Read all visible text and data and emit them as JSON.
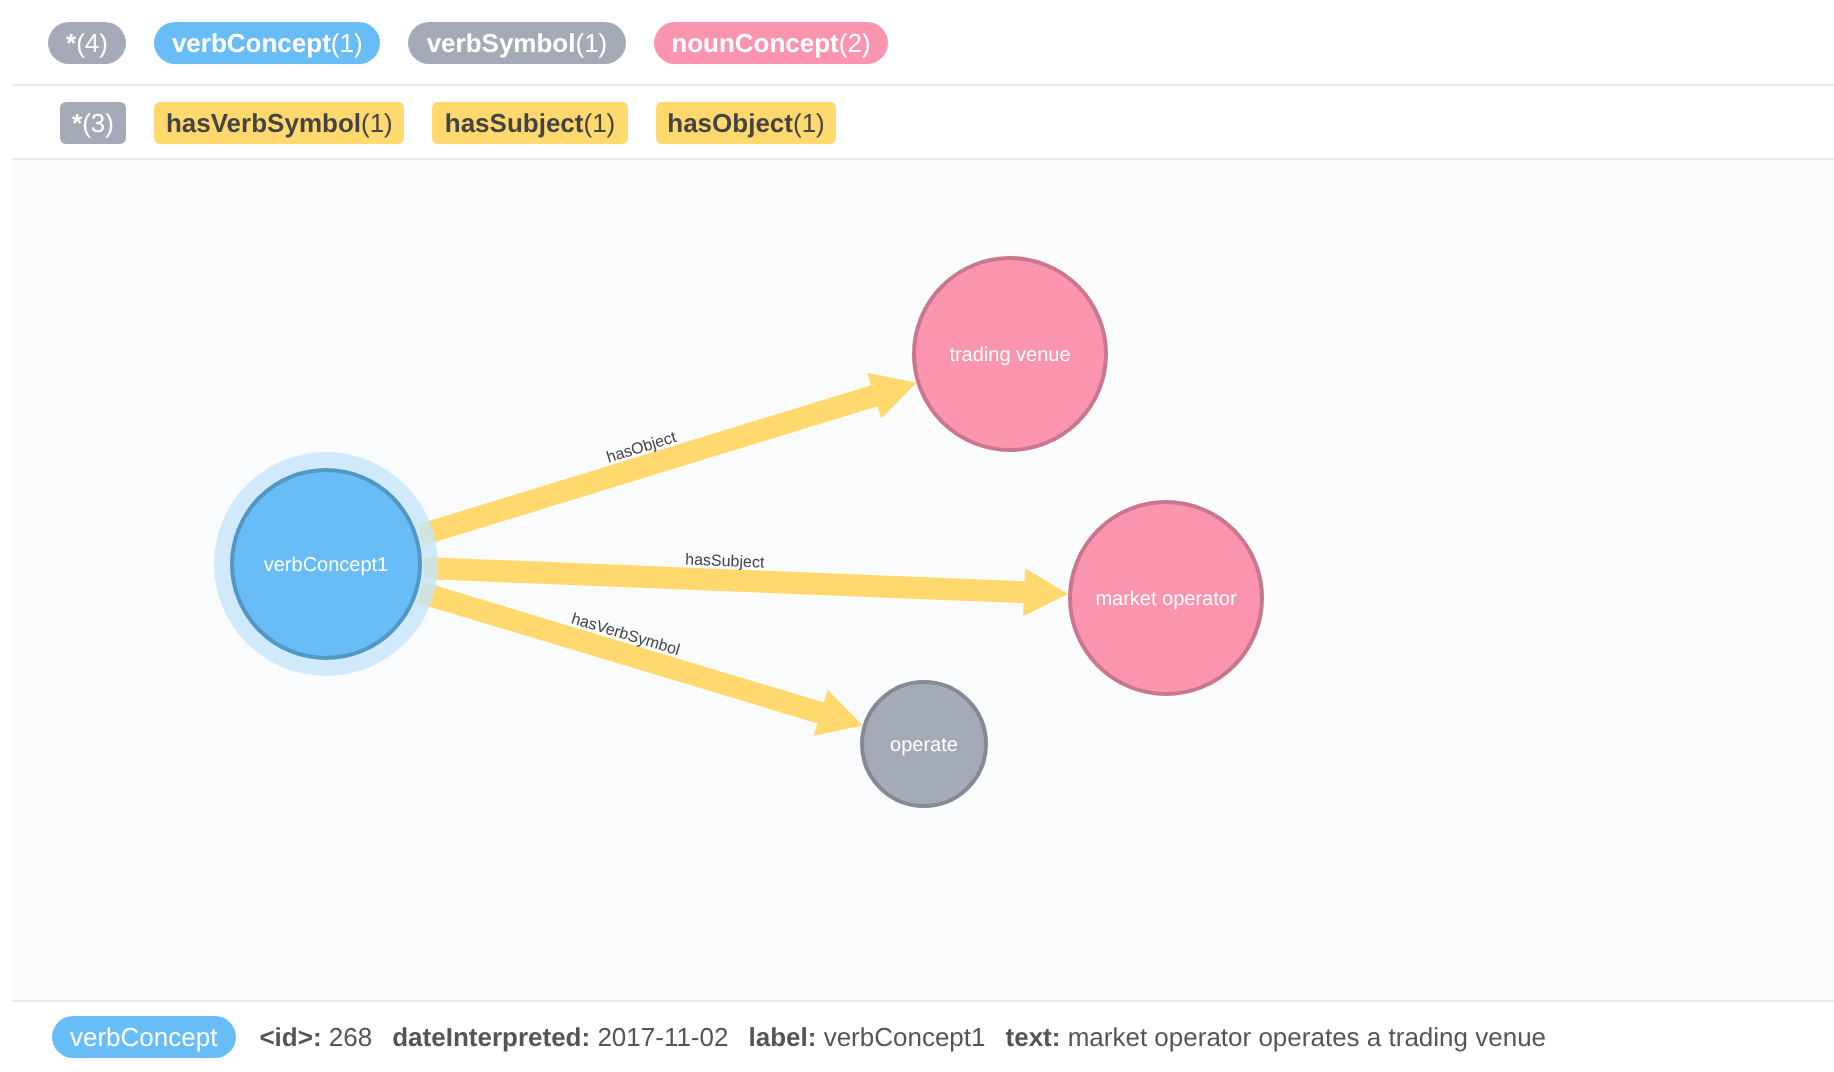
{
  "node_labels": [
    {
      "name": "*",
      "count": "(4)",
      "color": "#a5abb6"
    },
    {
      "name": "verbConcept",
      "count": "(1)",
      "color": "#68bdf6"
    },
    {
      "name": "verbSymbol",
      "count": "(1)",
      "color": "#a5abb6"
    },
    {
      "name": "nounConcept",
      "count": "(2)",
      "color": "#fb95af"
    }
  ],
  "relationship_types": [
    {
      "name": "*",
      "count": "(3)",
      "color": "#a5abb6"
    },
    {
      "name": "hasVerbSymbol",
      "count": "(1)",
      "color": "#ffd86e"
    },
    {
      "name": "hasSubject",
      "count": "(1)",
      "color": "#ffd86e"
    },
    {
      "name": "hasObject",
      "count": "(1)",
      "color": "#ffd86e"
    }
  ],
  "graph": {
    "nodes": [
      {
        "caption": "verbConcept1",
        "color": "#68bdf6",
        "selected": true
      },
      {
        "caption": "trading venue",
        "color": "#fb95af",
        "selected": false
      },
      {
        "caption": "market operator",
        "color": "#fb95af",
        "selected": false
      },
      {
        "caption": "operate",
        "color": "#a5abb6",
        "selected": false
      }
    ],
    "relationships": [
      {
        "type": "hasObject"
      },
      {
        "type": "hasSubject"
      },
      {
        "type": "hasVerbSymbol"
      }
    ]
  },
  "inspector": {
    "labels": [
      {
        "text": "verbConcept",
        "color": "#68bdf6"
      }
    ],
    "properties": [
      {
        "key": "<id>:",
        "value": "268"
      },
      {
        "key": "dateInterpreted:",
        "value": "2017-11-02"
      },
      {
        "key": "label:",
        "value": "verbConcept1"
      },
      {
        "key": "text:",
        "value": "market operator operates a trading venue"
      }
    ]
  }
}
